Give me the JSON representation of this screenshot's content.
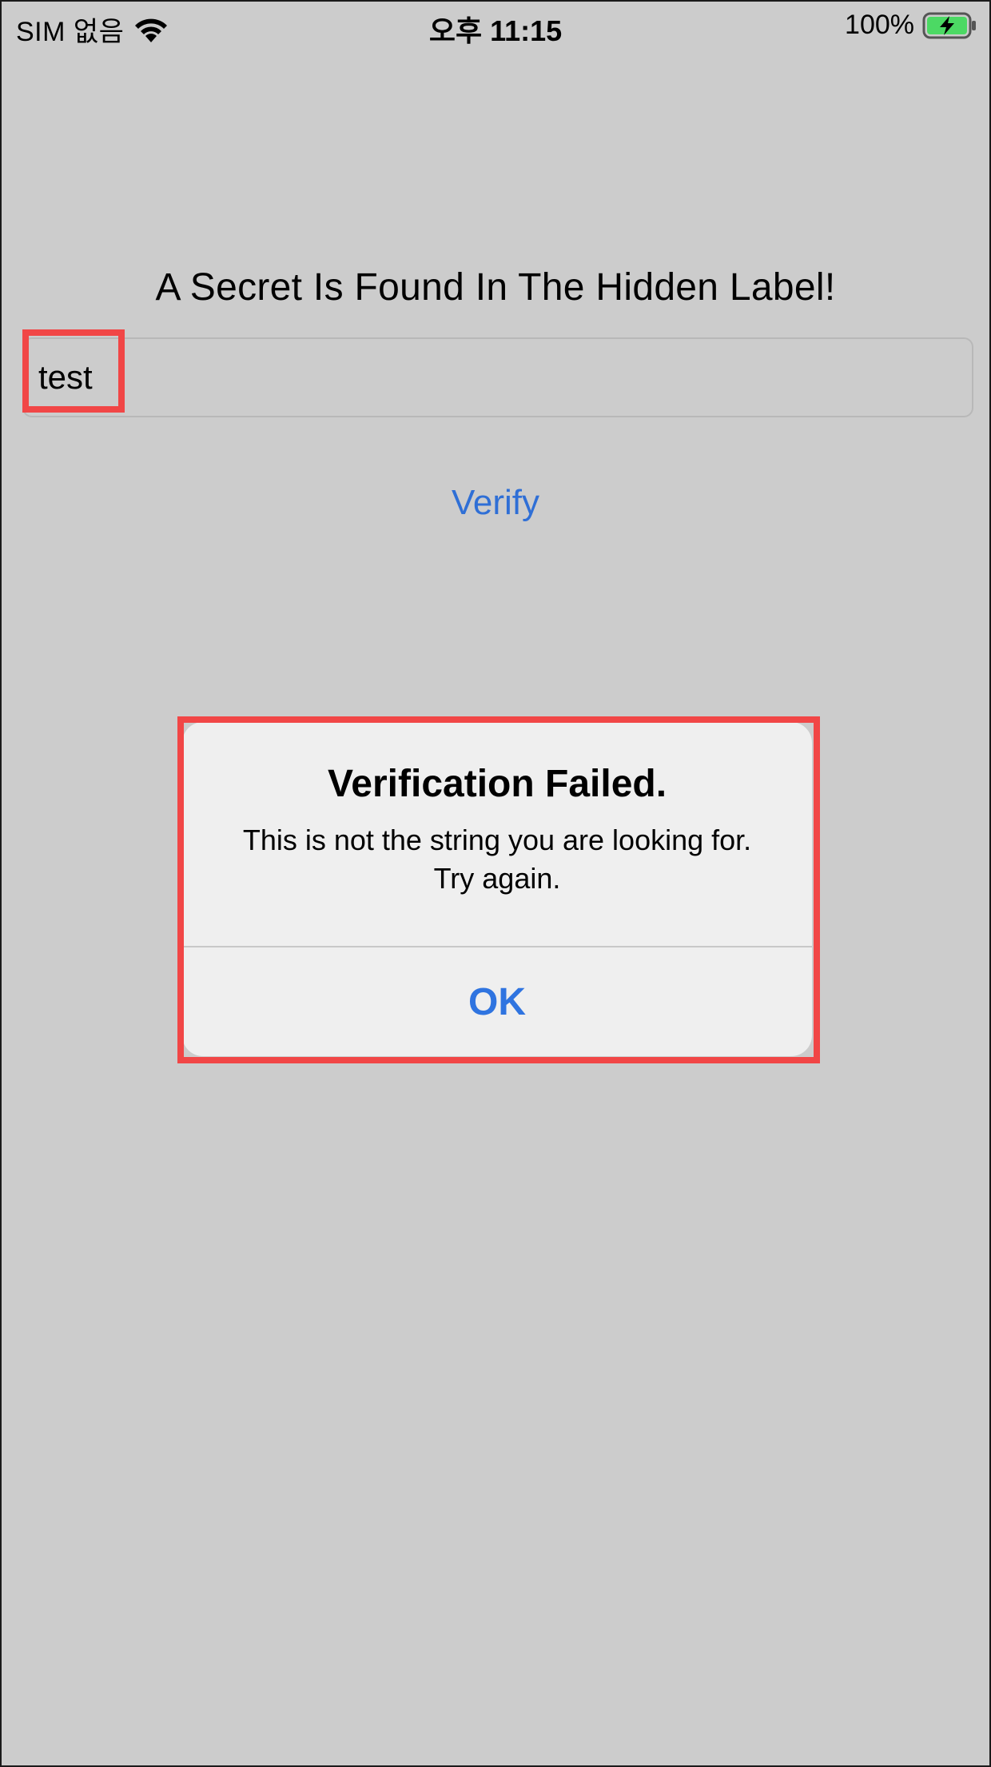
{
  "status_bar": {
    "carrier": "SIM 없음",
    "time": "오후 11:15",
    "battery_percent": "100%",
    "wifi_icon": "wifi-icon",
    "battery_icon": "battery-charging-icon",
    "battery_level": 1.0,
    "battery_color": "#4cd964"
  },
  "main": {
    "title": "A Secret Is Found In The Hidden Label!",
    "input_value": "test",
    "verify_label": "Verify"
  },
  "alert": {
    "title": "Verification Failed.",
    "message": "This is not the string you are looking for. Try again.",
    "ok_label": "OK"
  },
  "colors": {
    "background": "#cccccc",
    "accent_blue": "#2f6fd6",
    "highlight_red": "#f14646",
    "alert_background": "#efefef"
  }
}
